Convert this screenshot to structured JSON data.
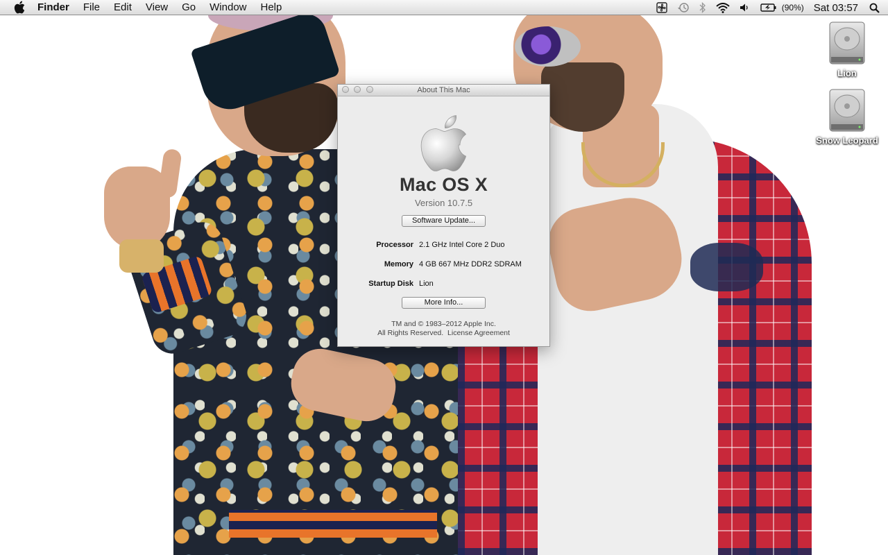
{
  "menubar": {
    "apple_icon": "apple-icon",
    "app_name": "Finder",
    "items": [
      "File",
      "Edit",
      "View",
      "Go",
      "Window",
      "Help"
    ],
    "status": {
      "battery_percent": "(90%)",
      "clock": "Sat 03:57",
      "icons": [
        "cooling-fan-icon",
        "time-machine-icon",
        "bluetooth-icon",
        "wifi-icon",
        "volume-icon",
        "battery-icon",
        "spotlight-search-icon"
      ]
    }
  },
  "desktop": {
    "icons": [
      {
        "label": "Lion",
        "icon": "hard-disk-icon"
      },
      {
        "label": "Snow Leopard",
        "icon": "hard-disk-icon"
      }
    ]
  },
  "about_window": {
    "title": "About This Mac",
    "os_name": "Mac OS X",
    "version": "Version 10.7.5",
    "software_update_button": "Software Update...",
    "specs": [
      {
        "label": "Processor",
        "value": "2.1 GHz Intel Core 2 Duo"
      },
      {
        "label": "Memory",
        "value": "4 GB 667 MHz DDR2 SDRAM"
      },
      {
        "label": "Startup Disk",
        "value": "Lion"
      }
    ],
    "more_info_button": "More Info...",
    "copyright": "TM and © 1983–2012 Apple Inc.",
    "rights": "All Rights Reserved.",
    "license_link": "License Agreement"
  },
  "colors": {
    "menubar_top": "#f7f7f7",
    "menubar_bottom": "#dcdcdc",
    "window_bg": "#ececec",
    "desktop_bg": "#ffffff"
  }
}
